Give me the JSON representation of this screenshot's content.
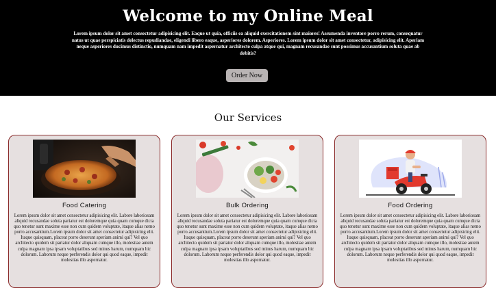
{
  "hero": {
    "title": "Welcome to my Online Meal",
    "description": "Lorem ipsum dolor sit amet consectetur adipisicing elit. Eaque ut quia, officiis ea aliquid exercitationem sint maiores! Assumenda inventore porro rerum, consequatur natus ut quae perspiciatis delectus repudiandae, eligendi libero eaque, asperiores dolorem. Asperiores. Lorem ipsum dolor sit amet consectetur, adipisicing elit. Aperiam neque asperiores ducimus distinctio, numquam nam impedit aspernatur architecto culpa atque qui, magnam recusandae sunt possimus accusantium soluta quae ab debitis?",
    "button_label": "Order Now"
  },
  "services": {
    "heading": "Our Services",
    "cards": [
      {
        "title": "Food Catering",
        "text": "Lorem ipsum dolor sit amet consectetur adipisicing elit. Labore laboriosam aliquid recusandae soluta pariatur est doloremque quia quam cumque dicta quo tenetur sunt maxime esse non cum quidem voluptate, itaque alias nemo porro accusantium.Lorem ipsum dolor sit amet consectetur adipisicing elit. Itaque quisquam, placeat porro deserunt aperiam animi qui? Vel quo architecto quidem sit pariatur dolor aliquam cumque illo, molestiae autem culpa magnam ipsa ipsam voluptatibus sed minus harum, numquam hic dolorum. Laborum neque perferendis dolor qui quod eaque, impedit molestias illo aspernatur."
      },
      {
        "title": "Bulk Ordering",
        "text": "Lorem ipsum dolor sit amet consectetur adipisicing elit. Labore laboriosam aliquid recusandae soluta pariatur est doloremque quia quam cumque dicta quo tenetur sunt maxime esse non cum quidem voluptate, itaque alias nemo porro accusantium.Lorem ipsum dolor sit amet consectetur adipisicing elit. Itaque quisquam, placeat porro deserunt aperiam animi qui? Vel quo architecto quidem sit pariatur dolor aliquam cumque illo, molestiae autem culpa magnam ipsa ipsam voluptatibus sed minus harum, numquam hic dolorum. Laborum neque perferendis dolor qui quod eaque, impedit molestias illo aspernatur."
      },
      {
        "title": "Food Ordering",
        "text": "Lorem ipsum dolor sit amet consectetur adipisicing elit. Labore laboriosam aliquid recusandae soluta pariatur est doloremque quia quam cumque dicta quo tenetur sunt maxime esse non cum quidem voluptate, itaque alias nemo porro accusantium.Lorem ipsum dolor sit amet consectetur adipisicing elit. Itaque quisquam, placeat porro deserunt aperiam animi qui? Vel quo architecto quidem sit pariatur dolor aliquam cumque illo, molestiae autem culpa magnam ipsa ipsam voluptatibus sed minus harum, numquam hic dolorum. Laborum neque perferendis dolor qui quod eaque, impedit molestias illo aspernatur."
      }
    ]
  },
  "colors": {
    "hero_background": "#000000",
    "card_background": "#e6e0e0",
    "card_border": "#8a2a2a",
    "button_background": "#b9b4b4"
  }
}
